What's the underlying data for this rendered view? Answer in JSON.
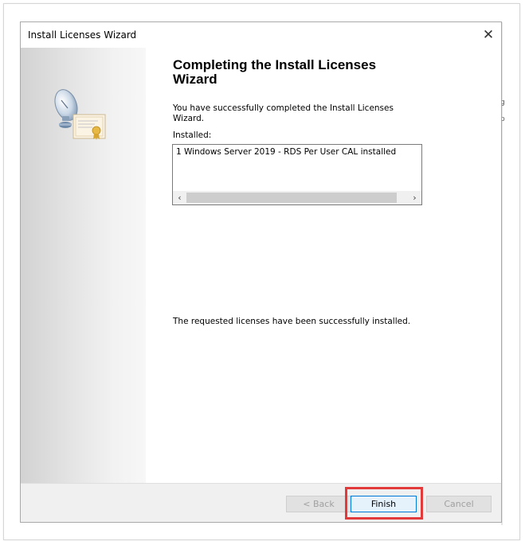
{
  "window": {
    "title": "Install Licenses Wizard",
    "close_glyph": "✕"
  },
  "page": {
    "heading": "Completing the Install Licenses Wizard",
    "description": "You have successfully completed the Install Licenses Wizard.",
    "installed_label": "Installed:",
    "installed_items": [
      "1 Windows Server 2019 - RDS Per User CAL installed"
    ],
    "status_message": "The requested licenses have been successfully installed."
  },
  "scrollbar": {
    "left_glyph": "‹",
    "right_glyph": "›"
  },
  "buttons": {
    "back": "< Back",
    "finish": "Finish",
    "cancel": "Cancel"
  },
  "background": {
    "edge_chars": [
      "g",
      "p"
    ]
  },
  "icons": {
    "wizard_art": "satellite-certificate-icon"
  },
  "colors": {
    "highlight": "#e23a3a",
    "default_button_border": "#0078d7"
  }
}
